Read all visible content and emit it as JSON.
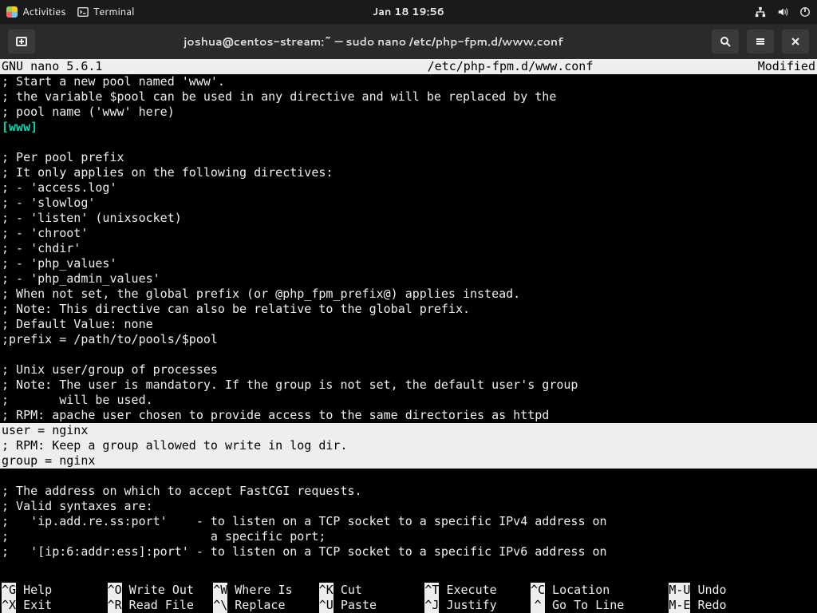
{
  "topbar": {
    "activities": "Activities",
    "terminal": "Terminal",
    "clock": "Jan 18  19:56"
  },
  "window": {
    "title": "joshua@centos-stream:~ — sudo nano /etc/php-fpm.d/www.conf"
  },
  "nano": {
    "app": "GNU nano 5.6.1",
    "file": "/etc/php-fpm.d/www.conf",
    "status": "Modified",
    "pool_header": "[www]",
    "body_pre": "; Start a new pool named 'www'.\n; the variable $pool can be used in any directive and will be replaced by the\n; pool name ('www' here)",
    "body_mid": "\n; Per pool prefix\n; It only applies on the following directives:\n; - 'access.log'\n; - 'slowlog'\n; - 'listen' (unixsocket)\n; - 'chroot'\n; - 'chdir'\n; - 'php_values'\n; - 'php_admin_values'\n; When not set, the global prefix (or @php_fpm_prefix@) applies instead.\n; Note: This directive can also be relative to the global prefix.\n; Default Value: none\n;prefix = /path/to/pools/$pool\n\n; Unix user/group of processes\n; Note: The user is mandatory. If the group is not set, the default user's group\n;       will be used.\n; RPM: apache user chosen to provide access to the same directories as httpd",
    "body_hl": "user = nginx\n; RPM: Keep a group allowed to write in log dir.\ngroup = nginx",
    "body_post": "\n; The address on which to accept FastCGI requests.\n; Valid syntaxes are:\n;   'ip.add.re.ss:port'    - to listen on a TCP socket to a specific IPv4 address on\n;                            a specific port;\n;   '[ip:6:addr:ess]:port' - to listen on a TCP socket to a specific IPv6 address on"
  },
  "shortcuts": {
    "r1": [
      {
        "k": "^G",
        "l": "Help"
      },
      {
        "k": "^O",
        "l": "Write Out"
      },
      {
        "k": "^W",
        "l": "Where Is"
      },
      {
        "k": "^K",
        "l": "Cut"
      },
      {
        "k": "^T",
        "l": "Execute"
      },
      {
        "k": "^C",
        "l": "Location"
      },
      {
        "k": "M-U",
        "l": "Undo"
      }
    ],
    "r2": [
      {
        "k": "^X",
        "l": "Exit"
      },
      {
        "k": "^R",
        "l": "Read File"
      },
      {
        "k": "^\\",
        "l": "Replace"
      },
      {
        "k": "^U",
        "l": "Paste"
      },
      {
        "k": "^J",
        "l": "Justify"
      },
      {
        "k": "^ ",
        "l": "Go To Line"
      },
      {
        "k": "M-E",
        "l": "Redo"
      }
    ]
  }
}
